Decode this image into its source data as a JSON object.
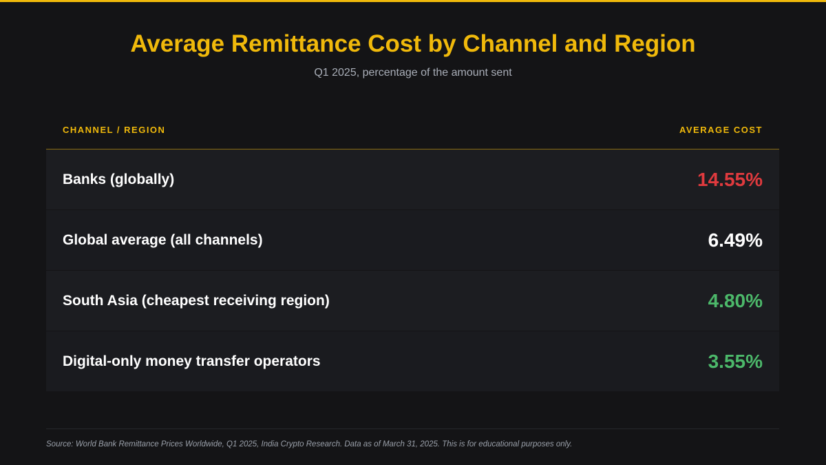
{
  "title": "Average Remittance Cost by Channel and Region",
  "subtitle": "Q1 2025, percentage of the amount sent",
  "colors": {
    "accent": "#f0b90b",
    "high": "#e03a3e",
    "neutral": "#ffffff",
    "low": "#4cb86a"
  },
  "chart_data": {
    "type": "table",
    "columns": [
      "CHANNEL / REGION",
      "AVERAGE COST"
    ],
    "rows": [
      {
        "label": "Banks (globally)",
        "value": 14.55,
        "display": "14.55%",
        "tone": "high"
      },
      {
        "label": "Global average (all channels)",
        "value": 6.49,
        "display": "6.49%",
        "tone": "neutral"
      },
      {
        "label": "South Asia (cheapest receiving region)",
        "value": 4.8,
        "display": "4.80%",
        "tone": "low"
      },
      {
        "label": "Digital-only money transfer operators",
        "value": 3.55,
        "display": "3.55%",
        "tone": "low"
      }
    ]
  },
  "source": "Source: World Bank Remittance Prices Worldwide, Q1 2025, India Crypto Research. Data as of March 31, 2025. This is for educational purposes only."
}
